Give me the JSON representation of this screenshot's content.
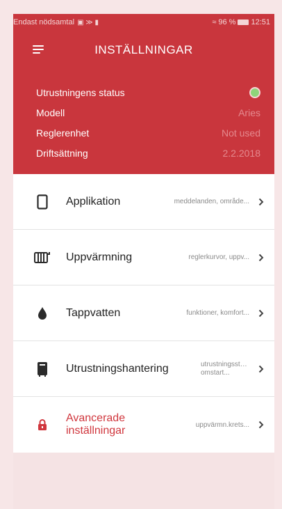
{
  "statusbar": {
    "left": "Endast nödsamtal",
    "battery_percent": "96 %",
    "time": "12:51"
  },
  "header": {
    "title": "INSTÄLLNINGAR",
    "status_color": "#8fd47a"
  },
  "info": {
    "status_label": "Utrustningens status",
    "model_label": "Modell",
    "model_value": "Aries",
    "controller_label": "Reglerenhet",
    "controller_value": "Not used",
    "commissioning_label": "Driftsättning",
    "commissioning_value": "2.2.2018"
  },
  "menu": [
    {
      "label": "Applikation",
      "desc": "meddelanden, område...",
      "icon": "tablet-icon"
    },
    {
      "label": "Uppvärmning",
      "desc": "reglerkurvor, uppv...",
      "icon": "radiator-icon"
    },
    {
      "label": "Tappvatten",
      "desc": "funktioner, komfort...",
      "icon": "water-drop-icon"
    },
    {
      "label": "Utrustningshantering",
      "desc": "utrustningsstatus, omstart...",
      "icon": "device-icon"
    },
    {
      "label": "Avancerade inställningar",
      "desc": "uppvärmn.krets...",
      "icon": "lock-icon"
    }
  ],
  "colors": {
    "header_bg": "#c9363d",
    "accent_red": "#d0363d"
  }
}
